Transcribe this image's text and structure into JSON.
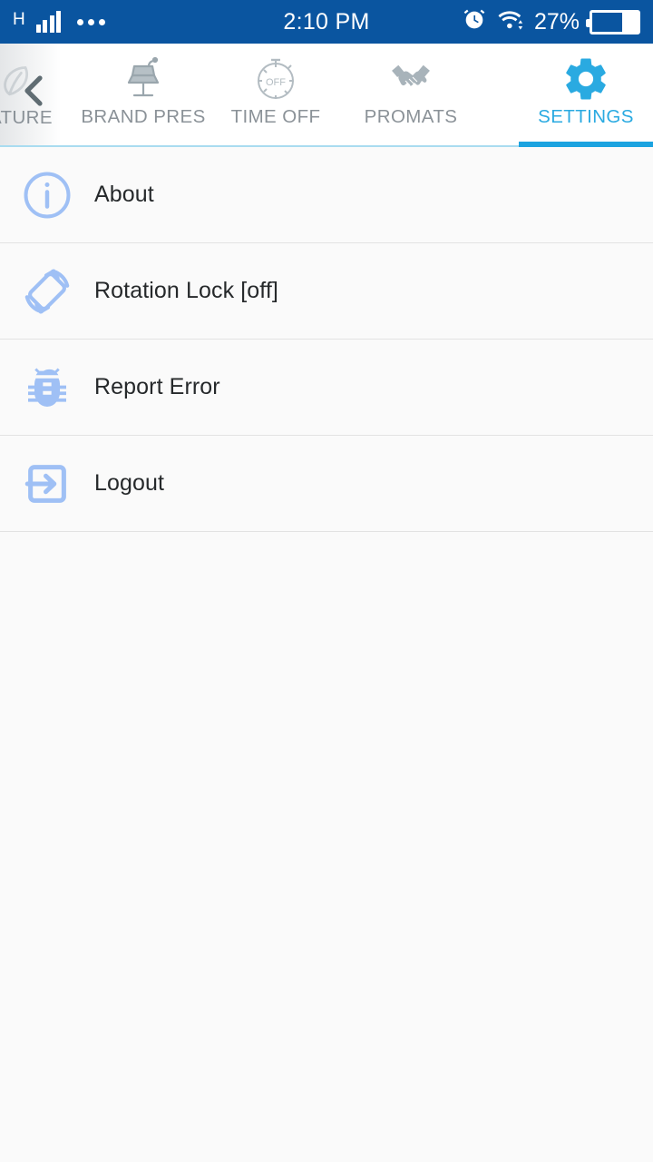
{
  "status_bar": {
    "network_type": "H",
    "signal_icon": "signal-bars-icon",
    "menu_icon": "three-dots-icon",
    "time": "2:10 PM",
    "alarm_icon": "alarm-clock-icon",
    "wifi_icon": "wifi-icon",
    "battery_percent": "27%",
    "battery_icon": "battery-icon",
    "background_color": "#0a55a0"
  },
  "tab_bar": {
    "accent_color": "#1ba3e0",
    "inactive_color": "#8b9298",
    "back_icon": "back-chevron-icon",
    "tabs": [
      {
        "id": "signature",
        "label": "ATURE",
        "icon": "signature-feather-icon",
        "active": false,
        "truncated": true
      },
      {
        "id": "brand-pres",
        "label": "BRAND PRES",
        "icon": "podium-lectern-icon",
        "active": false,
        "truncated": false
      },
      {
        "id": "time-off",
        "label": "TIME OFF",
        "icon": "stopwatch-off-icon",
        "active": false,
        "truncated": false
      },
      {
        "id": "promats",
        "label": "PROMATS",
        "icon": "handshake-icon",
        "active": false,
        "truncated": false
      },
      {
        "id": "settings",
        "label": "SETTINGS",
        "icon": "gear-icon",
        "active": true,
        "truncated": false
      }
    ]
  },
  "settings_list": {
    "icon_color": "#9fc0f5",
    "items": [
      {
        "id": "about",
        "label": "About",
        "icon": "info-circle-icon"
      },
      {
        "id": "rotation-lock",
        "label": "Rotation Lock [off]",
        "icon": "screen-rotation-icon"
      },
      {
        "id": "report-error",
        "label": "Report Error",
        "icon": "bug-icon"
      },
      {
        "id": "logout",
        "label": "Logout",
        "icon": "logout-arrow-icon"
      }
    ]
  }
}
